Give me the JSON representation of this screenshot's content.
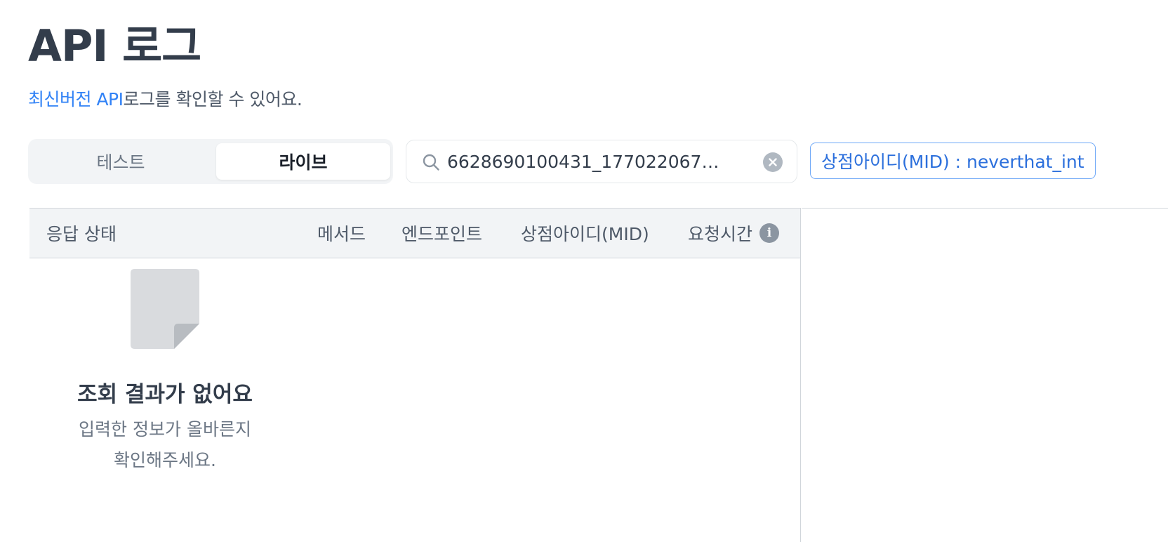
{
  "header": {
    "title": "API 로그",
    "subtitle_link": "최신버전 API",
    "subtitle_rest": "로그를 확인할 수 있어요."
  },
  "env_toggle": {
    "options": [
      "테스트",
      "라이브"
    ],
    "selected": "라이브"
  },
  "search": {
    "value": "6628690100431_1770220677..."
  },
  "filter_chip": {
    "label": "상점아이디(MID) : neverthat_int"
  },
  "table": {
    "columns": {
      "status": "응답 상태",
      "method": "메서드",
      "endpoint": "엔드포인트",
      "mid": "상점아이디(MID)",
      "time": "요청시간"
    }
  },
  "empty_state": {
    "title": "조회 결과가 없어요",
    "line1": "입력한 정보가 올바른지",
    "line2": "확인해주세요."
  },
  "colors": {
    "accent": "#3182f6",
    "chip_text": "#2b6fdc",
    "heading": "#333d4b",
    "header_bg": "#f2f4f6"
  }
}
